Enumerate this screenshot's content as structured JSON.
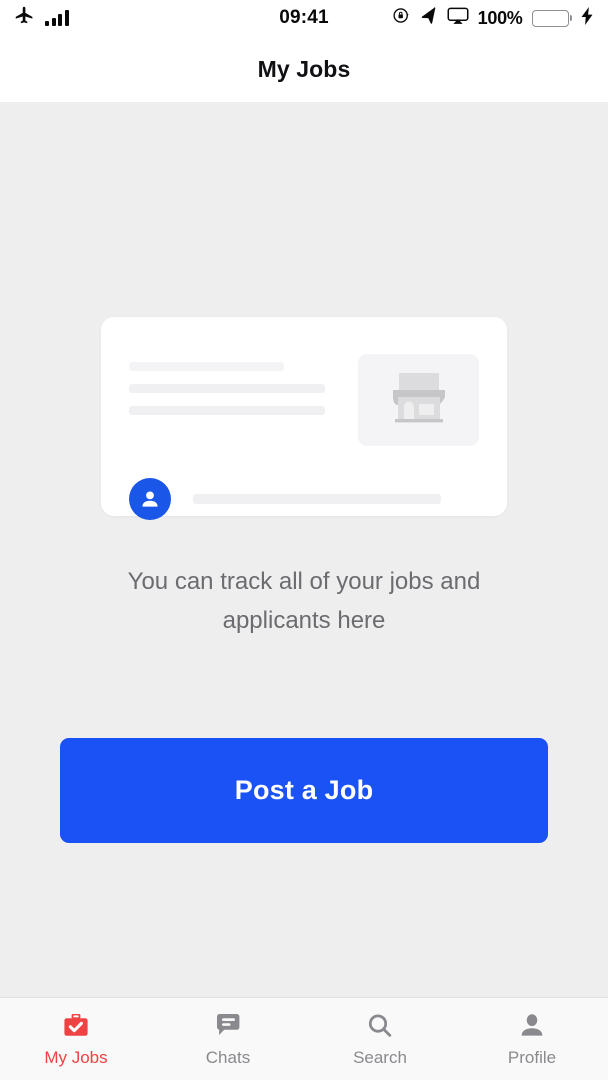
{
  "status_bar": {
    "airplane_icon": "airplane-mode-icon",
    "signal_icon": "signal-strength-icon",
    "time": "09:41",
    "rotation_lock_icon": "rotation-lock-icon",
    "location_icon": "location-arrow-icon",
    "airplay_icon": "screen-mirroring-icon",
    "battery_percent": "100%",
    "battery_icon": "battery-full-icon",
    "charging_icon": "charging-bolt-icon",
    "battery_color": "#4cd964"
  },
  "header": {
    "title": "My Jobs"
  },
  "illustration": {
    "card_name": "job-card-placeholder",
    "store_icon": "storefront-icon",
    "avatar_icon": "person-avatar-icon",
    "avatar_color": "#1a56e8"
  },
  "empty_state": {
    "caption": "You can track all of your jobs and applicants here"
  },
  "cta": {
    "label": "Post a Job",
    "color": "#1a52f5"
  },
  "tabbar": {
    "active_color": "#ef4343",
    "inactive_color": "#8a8a8e",
    "items": [
      {
        "label": "My Jobs",
        "icon": "briefcase-check-icon",
        "active": true
      },
      {
        "label": "Chats",
        "icon": "chat-bubble-icon",
        "active": false
      },
      {
        "label": "Search",
        "icon": "search-icon",
        "active": false
      },
      {
        "label": "Profile",
        "icon": "person-icon",
        "active": false
      }
    ]
  }
}
